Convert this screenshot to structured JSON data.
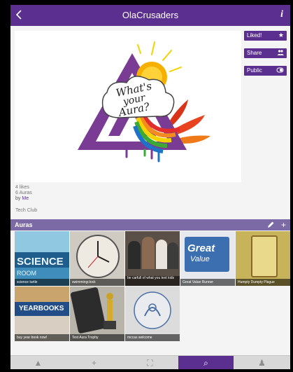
{
  "header": {
    "title": "OlaCrusaders",
    "back_icon": "chevron-left-icon",
    "info_icon": "info-icon"
  },
  "image_text": {
    "line1": "What's",
    "line2": "your",
    "line3": "Aura?"
  },
  "actions": [
    {
      "label": "Liked!",
      "icon": "star-icon"
    },
    {
      "label": "Share",
      "icon": "people-icon"
    },
    {
      "label": "Public",
      "icon": "toggle-icon"
    }
  ],
  "stats": {
    "likes": "4 likes",
    "auras": "6 Auras",
    "by_label": "by",
    "by_user": "Me"
  },
  "club": "Tech Club",
  "auras_section": {
    "title": "Auras",
    "edit_icon": "pencil-icon",
    "add_icon": "plus-icon"
  },
  "auras": [
    {
      "caption": "science turtle",
      "text": "SCIENCE",
      "text2": "ROOM"
    },
    {
      "caption": "swimmingclock"
    },
    {
      "caption": "be carfull of what you text kids"
    },
    {
      "caption": "Great Value Runner",
      "text": "Great",
      "text2": "Value"
    },
    {
      "caption": "Humpty Dumpty Plague"
    },
    {
      "caption": "buy year book now!",
      "text": "YEARBOOKS"
    },
    {
      "caption": "Test Aura Trophy"
    },
    {
      "caption": "mccas welcome"
    }
  ],
  "tabs": [
    {
      "name": "home-tab",
      "icon": "aurasma-logo-icon",
      "glyph": "▲"
    },
    {
      "name": "add-tab",
      "icon": "plus-icon",
      "glyph": "+"
    },
    {
      "name": "scan-tab",
      "icon": "viewfinder-icon",
      "glyph": "⛶"
    },
    {
      "name": "search-tab",
      "icon": "search-icon",
      "glyph": "⌕"
    },
    {
      "name": "profile-tab",
      "icon": "profile-icon",
      "glyph": "♟"
    }
  ],
  "colors": {
    "brand": "#5b2f8f",
    "auras_bar": "#7b6aa6",
    "tabbar": "#d8d8d8"
  }
}
